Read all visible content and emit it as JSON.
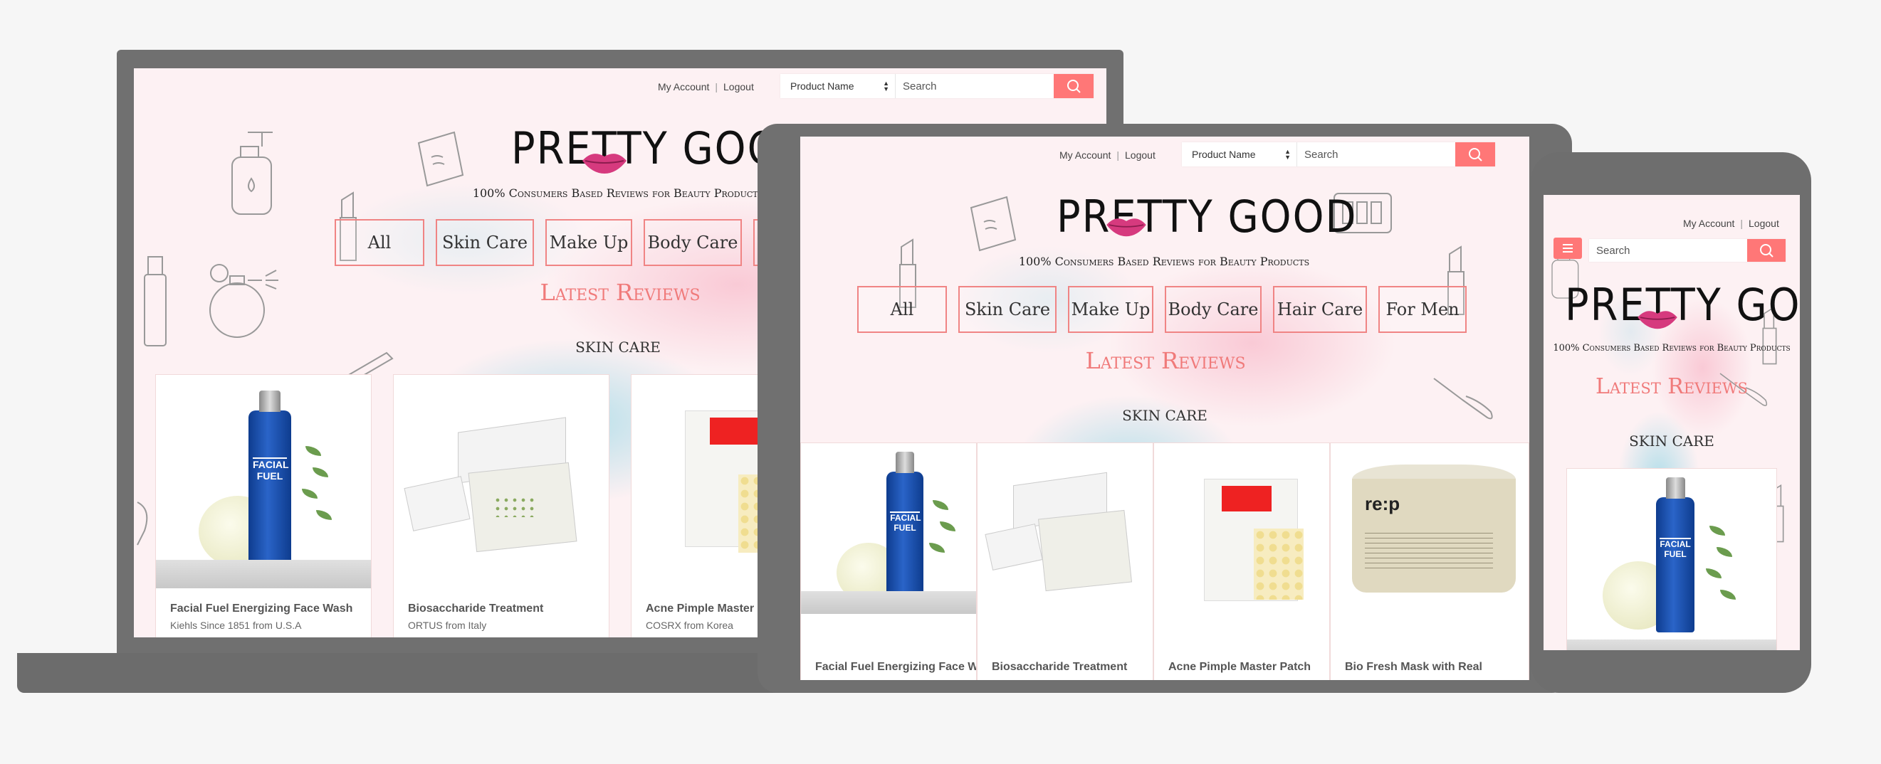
{
  "topbar": {
    "my_account": "My Account",
    "separator": "|",
    "logout": "Logout"
  },
  "search": {
    "category": "Product Name",
    "placeholder": "Search"
  },
  "brand": {
    "logo_left": "PRETTY",
    "logo_right": "GOOD",
    "tagline": "100% Consumers Based Reviews for Beauty Products"
  },
  "categories": [
    "All",
    "Skin Care",
    "Make Up",
    "Body Care",
    "Hair Care",
    "For Men"
  ],
  "latest_reviews": "Latest Reviews",
  "section": "SKIN CARE",
  "products": [
    {
      "name": "Facial Fuel Energizing Face Wash",
      "sub": "Kiehls Since 1851 from U.S.A"
    },
    {
      "name": "Biosaccharide Treatment",
      "sub": "ORTUS from Italy"
    },
    {
      "name": "Acne Pimple Master Patch",
      "sub": "COSRX from Korea"
    },
    {
      "name": "Bio Fresh Mask with Real",
      "sub": ""
    }
  ],
  "colors": {
    "accent": "#ff7777",
    "device": "#707070",
    "background": "#f6f6f6"
  }
}
